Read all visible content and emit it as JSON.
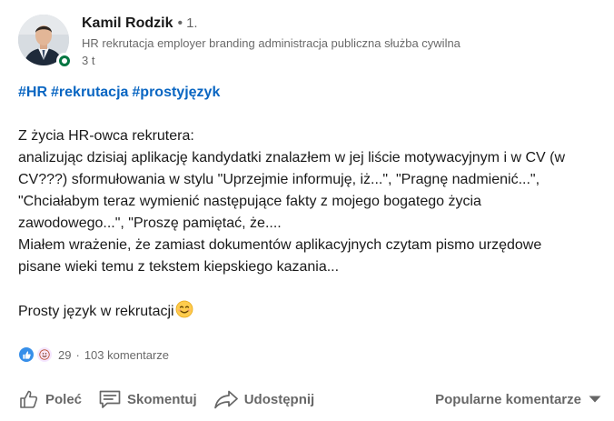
{
  "author": {
    "name": "Kamil Rodzik",
    "separator": "•",
    "degree": "1.",
    "headline": "HR rekrutacja employer branding administracja publiczna służba cywilna",
    "time": "3 t"
  },
  "post": {
    "hashtags": [
      "#HR",
      "#rekrutacja",
      "#prostyjęzyk"
    ],
    "lines": [
      "Z życia HR-owca rekrutera:",
      "analizując dzisiaj aplikację kandydatki znalazłem w jej liście motywacyjnym i w CV (w",
      "CV???) sformułowania w stylu \"Uprzejmie informuję, iż...\", \"Pragnę nadmienić...\",",
      "\"Chciałabym teraz wymienić następujące fakty z mojego bogatego życia",
      "zawodowego...\", \"Proszę pamiętać, że....",
      "Miałem wrażenie, że zamiast dokumentów aplikacyjnych czytam  pismo urzędowe",
      "pisane wieki temu z tekstem kiepskiego kazania..."
    ],
    "closing": "Prosty język w rekrutacji"
  },
  "social": {
    "reaction_count": "29",
    "dot": "·",
    "comments": "103 komentarze"
  },
  "actions": {
    "like": "Poleć",
    "comment": "Skomentuj",
    "share": "Udostępnij",
    "sort": "Popularne komentarze"
  },
  "icons": {
    "presence": "online-status-icon",
    "like": "thumbs-up-icon",
    "comment": "comment-icon",
    "share": "share-arrow-icon",
    "sort": "caret-down-icon",
    "reaction_like": "like-reaction-icon",
    "reaction_insightful": "insightful-reaction-icon",
    "emoji": "smiling-face-emoji"
  },
  "colors": {
    "hashtag": "#0a66c2",
    "presence": "#057642",
    "reaction_like": "#378fe9",
    "reaction_insightful": "#f5bb5c"
  }
}
